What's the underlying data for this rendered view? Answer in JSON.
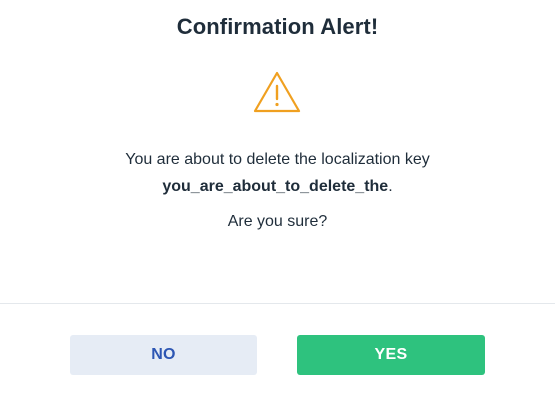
{
  "dialog": {
    "title": "Confirmation Alert!",
    "icon": "warning-icon",
    "accent_color": "#f0a020",
    "message_prefix": "You are about to delete the localization key",
    "message_key": "you_are_about_to_delete_the",
    "message_suffix": ".",
    "question": "Are you sure?",
    "no_label": "NO",
    "yes_label": "YES",
    "no_color": "#2d56b3",
    "yes_color": "#2ec27e"
  }
}
